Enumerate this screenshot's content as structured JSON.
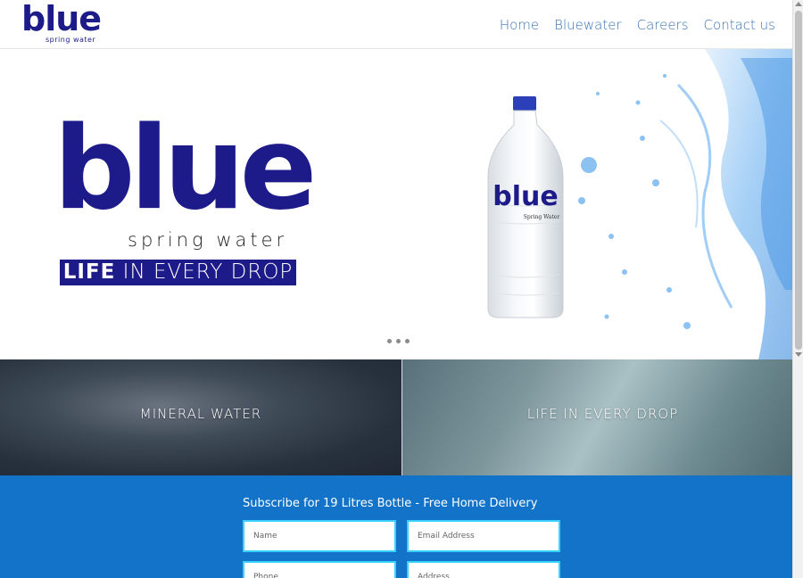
{
  "brand": {
    "logo_word": "blue",
    "logo_sub": "spring water",
    "primary_color": "#1d1a8a",
    "nav_color": "#3a72b3"
  },
  "nav": {
    "items": [
      {
        "label": "Home"
      },
      {
        "label": "Bluewater"
      },
      {
        "label": "Careers"
      },
      {
        "label": "Contact us"
      }
    ]
  },
  "hero": {
    "word": "blue",
    "sub": "spring water",
    "tag_bold": "LIFE",
    "tag_rest": " IN EVERY DROP",
    "bottle_label": "blue",
    "bottle_sub": "Spring Water",
    "slides": 3
  },
  "tiles": [
    {
      "label": "MINERAL WATER"
    },
    {
      "label": "LIFE IN EVERY DROP"
    }
  ],
  "subscribe": {
    "title": "Subscribe for 19 Litres Bottle - Free Home Delivery",
    "background": "#1273c8",
    "fields": {
      "name_placeholder": "Name",
      "email_placeholder": "Email Address",
      "phone_placeholder": "Phone",
      "address_placeholder": "Address"
    }
  }
}
